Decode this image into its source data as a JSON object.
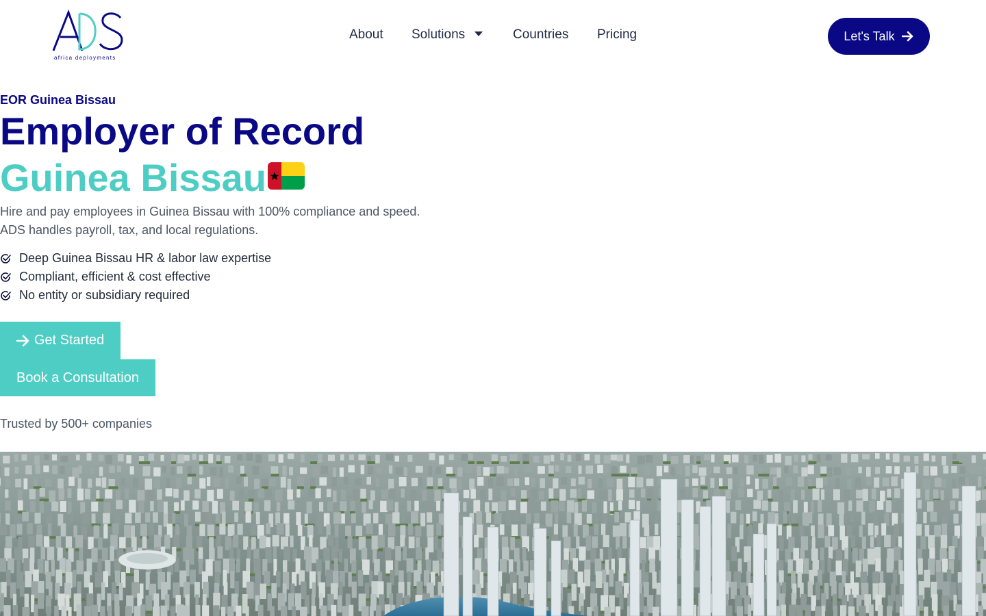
{
  "header": {
    "logo": {
      "mark": "ADS",
      "tagline": "africa deployments",
      "colors": {
        "navy": "#0a0885",
        "teal": "#4ecdc4"
      }
    },
    "nav": [
      {
        "label": "About"
      },
      {
        "label": "Solutions",
        "has_dropdown": true
      },
      {
        "label": "Countries"
      },
      {
        "label": "Pricing"
      }
    ],
    "cta": {
      "label": "Let's Talk",
      "icon": "arrow-right-icon"
    }
  },
  "hero": {
    "eyebrow": "EOR Guinea Bissau",
    "title_line1": "Employer of Record",
    "title_line2": "Guinea Bissau",
    "flag": "guinea-bissau-flag-icon",
    "lead_line1": "Hire and pay employees in Guinea Bissau with 100% compliance and speed.",
    "lead_line2": "ADS handles payroll, tax, and local regulations.",
    "features": [
      "Deep Guinea Bissau HR & labor law expertise",
      "Compliant, efficient & cost effective",
      "No entity or subsidiary required"
    ],
    "primary_button": "Get Started",
    "secondary_button": "Book a Consultation",
    "trusted": "Trusted by 500+ companies",
    "image": "aerial city skyline"
  },
  "colors": {
    "navy": "#0a0885",
    "teal": "#4ecdc4",
    "body_text": "#4b5563"
  }
}
